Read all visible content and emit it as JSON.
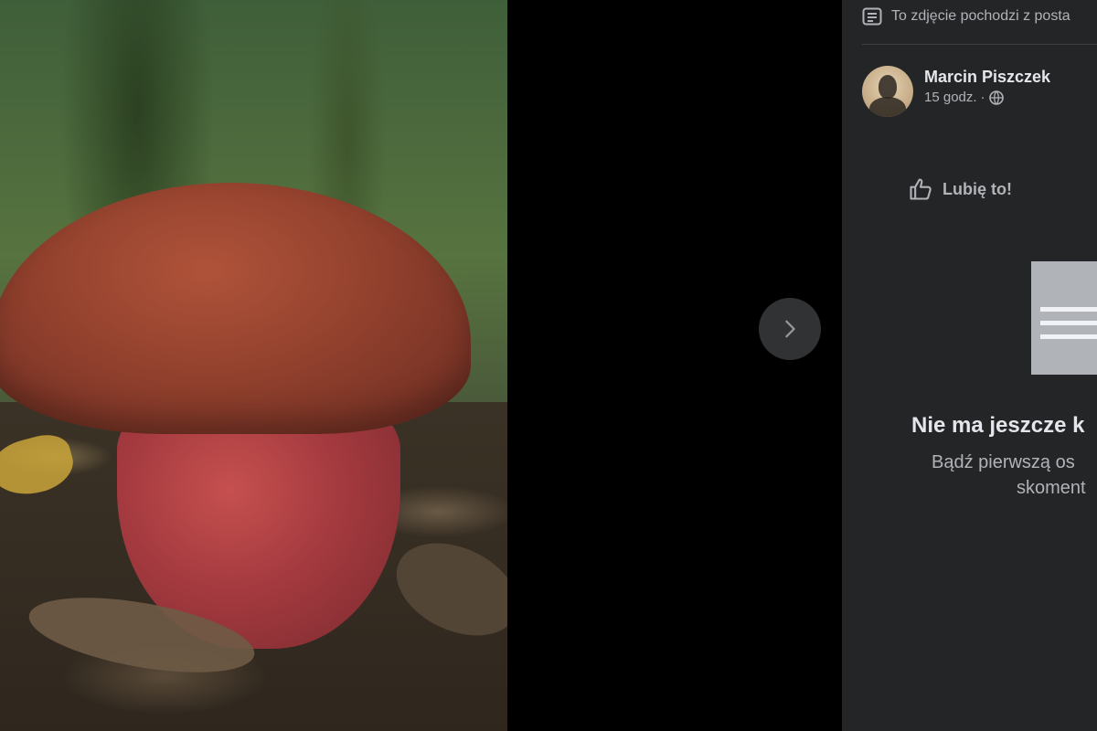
{
  "photo": {
    "alt": "mushroom photo"
  },
  "viewer": {
    "next_icon": "chevron-right-icon"
  },
  "sidebar": {
    "source_text": "To zdjęcie pochodzi z posta",
    "source_icon": "post-icon",
    "author": {
      "name": "Marcin Piszczek",
      "time": "15 godz.",
      "separator": "·",
      "privacy_icon": "globe-icon"
    },
    "like_label": "Lubię to!",
    "like_icon": "thumbs-up-icon",
    "empty": {
      "title": "Nie ma jeszcze k",
      "subtitle_line1": "Bądź pierwszą os",
      "subtitle_line2": "skoment"
    },
    "accent": "#1877f2"
  },
  "colors": {
    "sidebar_bg": "#242526",
    "text_primary": "#e4e6eb",
    "text_secondary": "#b0b3b8"
  }
}
